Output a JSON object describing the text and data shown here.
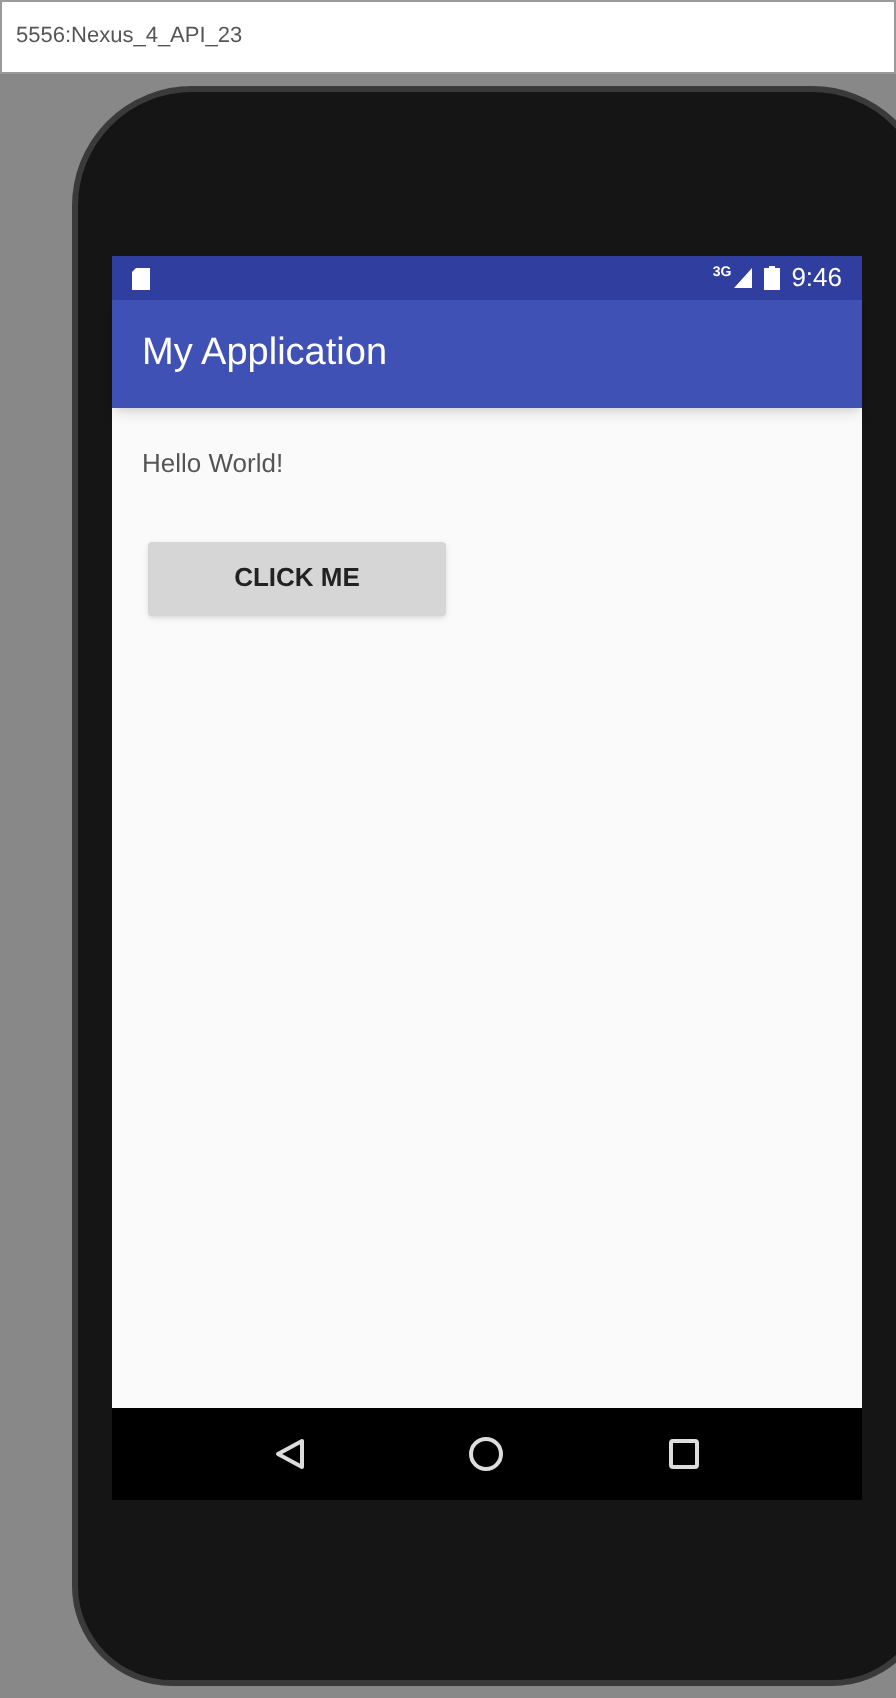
{
  "window": {
    "title": "5556:Nexus_4_API_23"
  },
  "status_bar": {
    "network": "3G",
    "time": "9:46"
  },
  "app_bar": {
    "title": "My Application"
  },
  "content": {
    "text": "Hello World!",
    "button": "CLICK ME"
  }
}
